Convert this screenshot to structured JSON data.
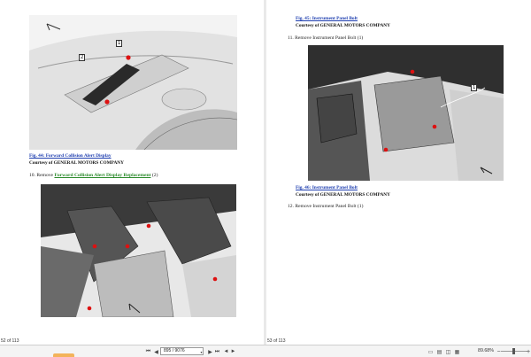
{
  "left_page": {
    "fig44_caption": "Fig. 44: Forward Collision Alert Display",
    "fig44_courtesy": "Courtesy of GENERAL MOTORS COMPANY",
    "step10_prefix": "10. Remove ",
    "step10_link": "Forward Collision Alert Display Replacement",
    "step10_suffix": " (2)",
    "page_number": "52 of 113",
    "callout_1": "1",
    "callout_2": "2"
  },
  "right_page": {
    "fig45_caption": "Fig. 45: Instrument Panel Bolt",
    "fig45_courtesy": "Courtesy of GENERAL MOTORS COMPANY",
    "step11": "11. Remove Instrument Panel Bolt (1)",
    "callout_1": "1",
    "fig46_caption": "Fig. 46: Instrument Panel Bolt",
    "fig46_courtesy": "Courtesy of GENERAL MOTORS COMPANY",
    "step12": "12. Remove Instrument Panel Bolt (1)",
    "page_number": "53 of 113"
  },
  "toolbar": {
    "page_value": "895 / 9076",
    "zoom": "89.68%"
  }
}
